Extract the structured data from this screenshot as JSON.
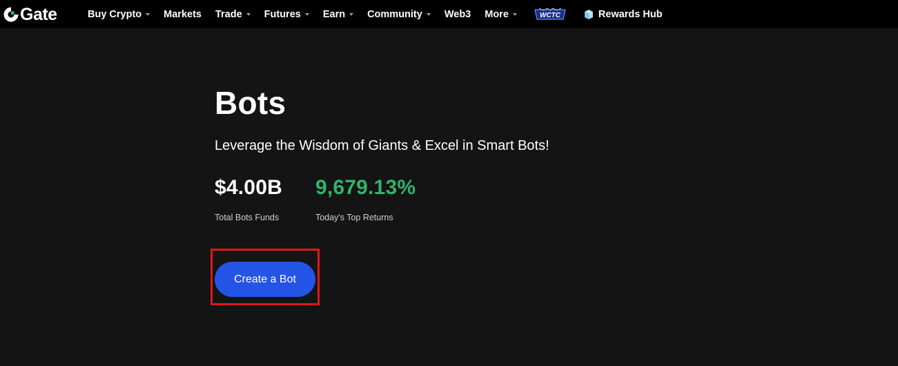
{
  "brand": {
    "name": "Gate",
    "accent_color": "#2354e6",
    "logo_icon": "gate-logo-icon"
  },
  "nav": {
    "items": [
      {
        "label": "Buy Crypto",
        "has_dropdown": true
      },
      {
        "label": "Markets",
        "has_dropdown": false
      },
      {
        "label": "Trade",
        "has_dropdown": true
      },
      {
        "label": "Futures",
        "has_dropdown": true
      },
      {
        "label": "Earn",
        "has_dropdown": true
      },
      {
        "label": "Community",
        "has_dropdown": true
      },
      {
        "label": "Web3",
        "has_dropdown": false
      },
      {
        "label": "More",
        "has_dropdown": true
      }
    ],
    "badge_label": "WCTC",
    "rewards_label": "Rewards Hub",
    "rewards_icon": "gift-box-icon"
  },
  "hero": {
    "title": "Bots",
    "subtitle": "Leverage the Wisdom of Giants & Excel in Smart Bots!",
    "stats": [
      {
        "value": "$4.00B",
        "label": "Total Bots Funds",
        "color": "#ffffff"
      },
      {
        "value": "9,679.13%",
        "label": "Today's Top Returns",
        "color": "#2fb46e"
      }
    ],
    "cta_label": "Create a Bot",
    "highlight_color": "#e41616"
  }
}
